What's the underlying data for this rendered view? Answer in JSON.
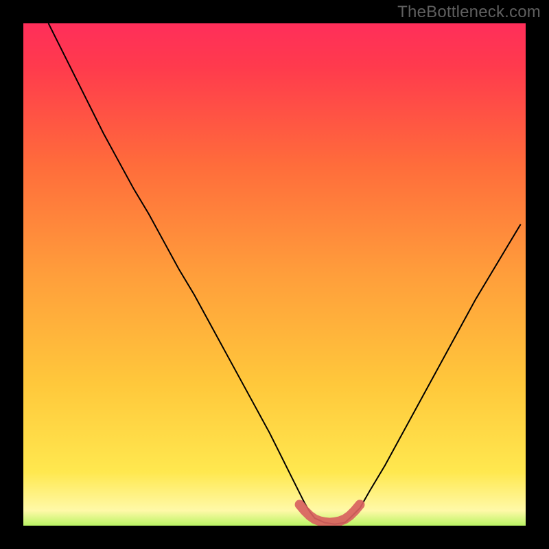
{
  "watermark": "TheBottleneck.com",
  "colors": {
    "frame_black": "#000000",
    "curve_black": "#000000",
    "green": "#2CE95C",
    "yellow_green": "#C3F53B",
    "pale_yellow": "#FFF9A8",
    "yellow": "#FFD53B",
    "orange": "#FFA13B",
    "orange2": "#FF7A3B",
    "red": "#FF2C52",
    "pink_red": "#FF2861",
    "marker_red": "#D8615F",
    "watermark_gray": "#5F5F5F"
  },
  "chart_data": {
    "type": "line",
    "title": "",
    "xlabel": "",
    "ylabel": "",
    "xlim": [
      0,
      100
    ],
    "ylim": [
      0,
      100
    ],
    "x": [
      5,
      7,
      10,
      13,
      16,
      19,
      22,
      25,
      28,
      31,
      34,
      37,
      40,
      43,
      46,
      49,
      51,
      53,
      55,
      56,
      57,
      58,
      60,
      62,
      64,
      65,
      67,
      69,
      72,
      75,
      78,
      81,
      84,
      87,
      90,
      93,
      96,
      99
    ],
    "values": [
      100,
      96,
      90,
      84,
      78,
      72.5,
      67,
      62,
      56.5,
      51,
      46,
      40.5,
      35,
      29.5,
      24,
      18.5,
      14.5,
      10.5,
      6.5,
      4.5,
      2.8,
      1.5,
      0.6,
      0.3,
      0.6,
      1.5,
      3.5,
      7,
      12,
      17.5,
      23,
      28.5,
      34,
      39.5,
      45,
      50,
      55,
      60
    ],
    "bottom_marker": {
      "x": [
        55,
        56,
        57,
        58,
        59,
        60,
        61,
        62,
        63,
        64,
        65,
        66,
        67
      ],
      "values": [
        4.2,
        3.0,
        2.0,
        1.3,
        0.9,
        0.7,
        0.6,
        0.7,
        0.9,
        1.3,
        2.0,
        3.0,
        4.2
      ]
    },
    "gradient_stops": [
      {
        "pos": 0.0,
        "color": "#2CE95C"
      },
      {
        "pos": 0.03,
        "color": "#9AF244"
      },
      {
        "pos": 0.07,
        "color": "#FFF9A8"
      },
      {
        "pos": 0.14,
        "color": "#FFE84F"
      },
      {
        "pos": 0.3,
        "color": "#FFC83B"
      },
      {
        "pos": 0.5,
        "color": "#FF9E3B"
      },
      {
        "pos": 0.7,
        "color": "#FF6C3B"
      },
      {
        "pos": 0.88,
        "color": "#FF3A4D"
      },
      {
        "pos": 1.0,
        "color": "#FF2861"
      }
    ]
  }
}
